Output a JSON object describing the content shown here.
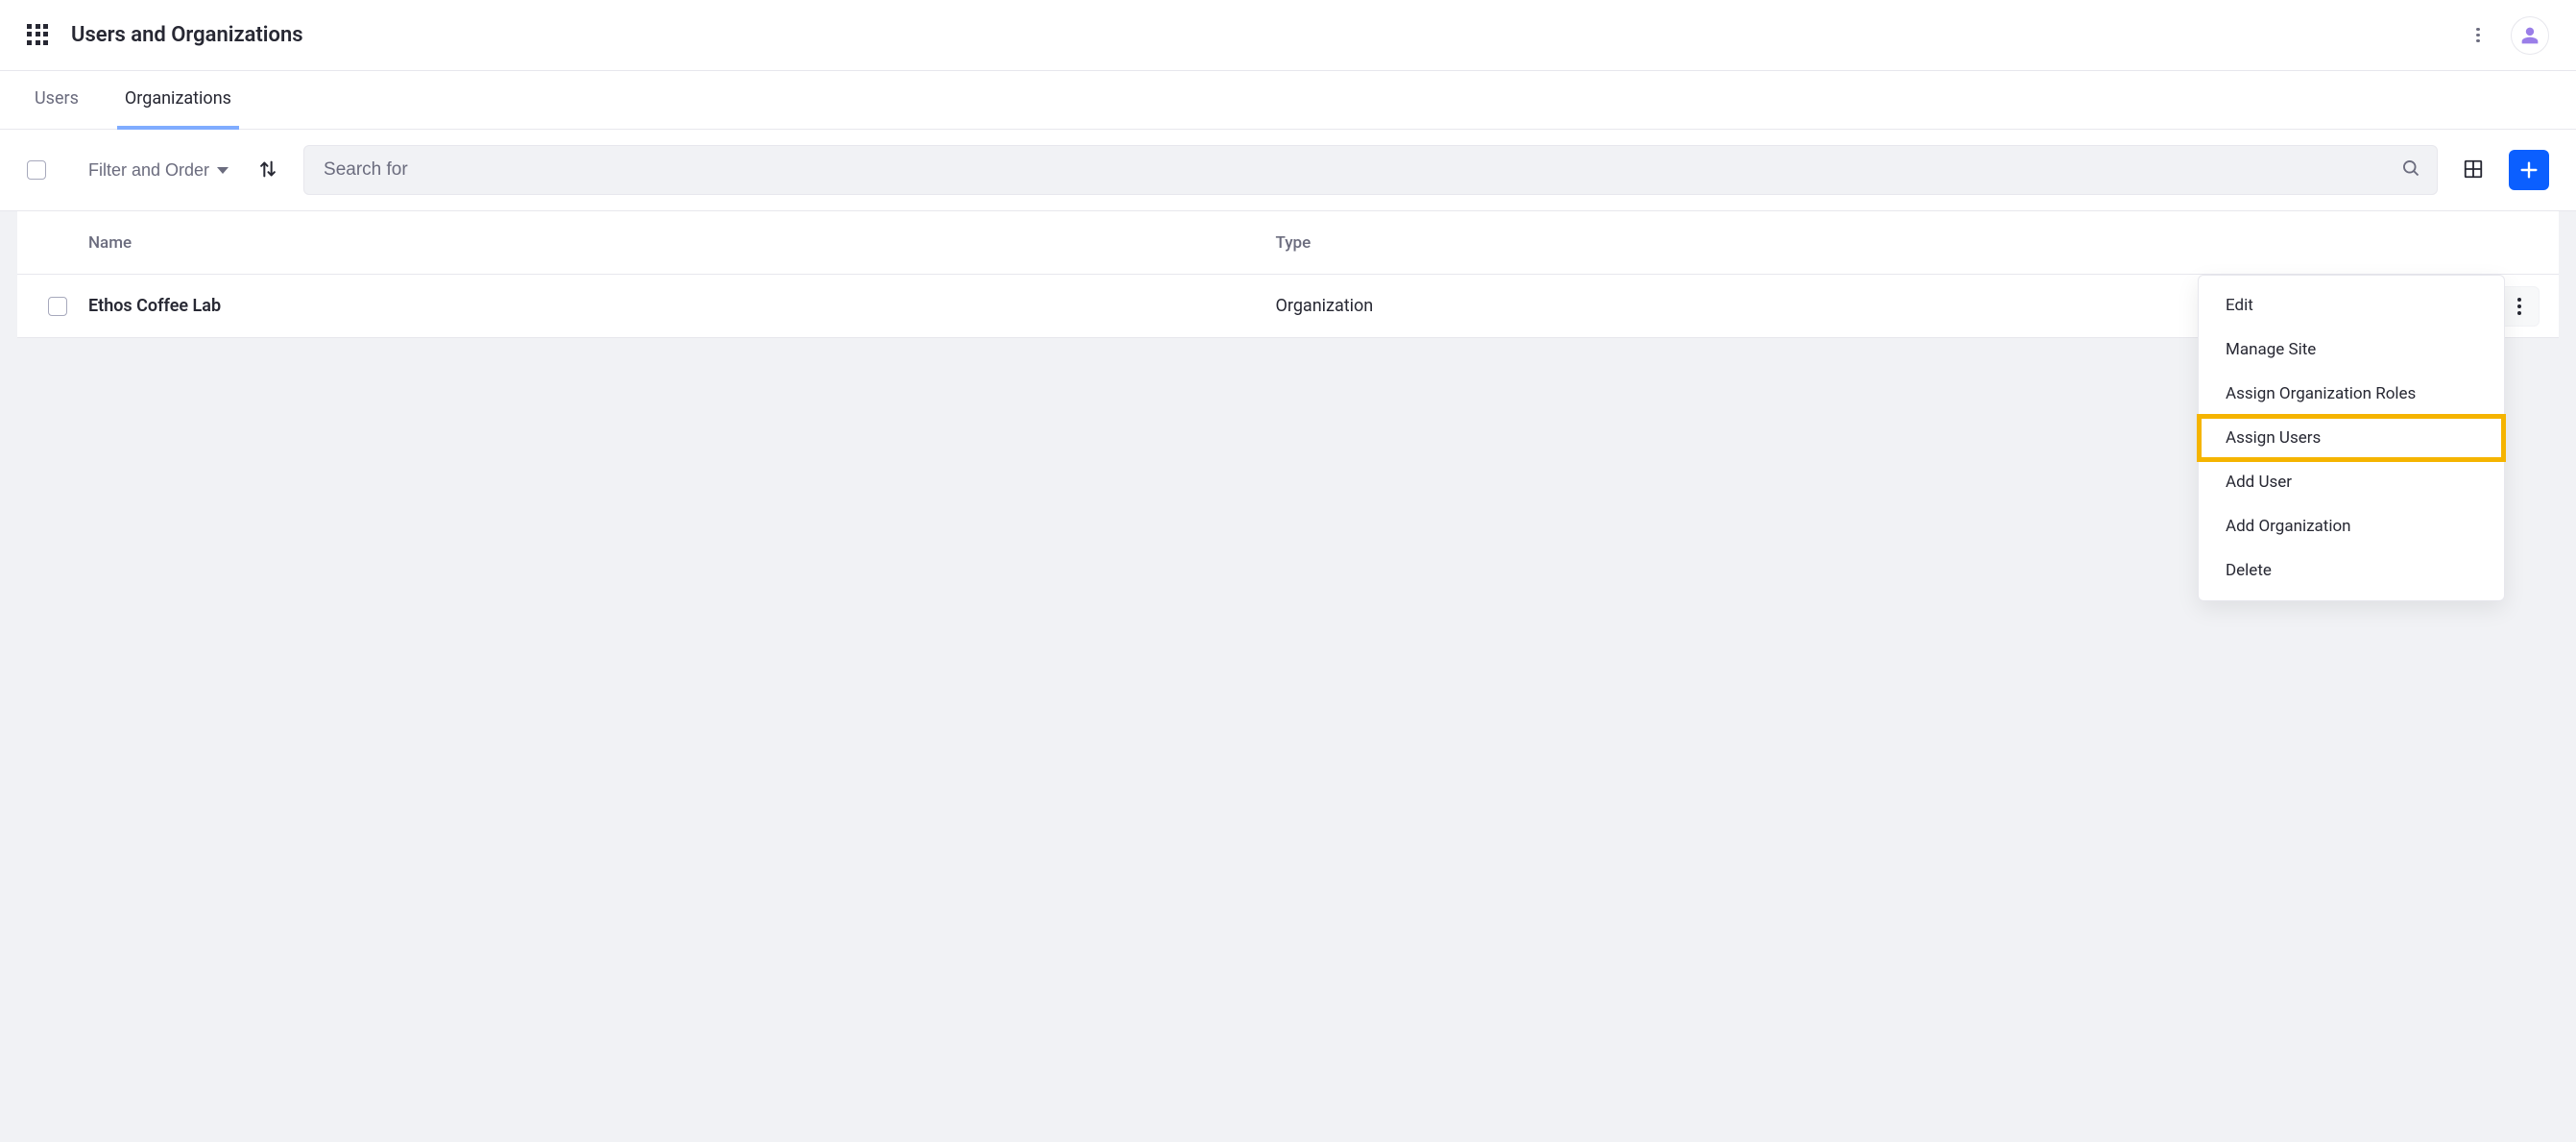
{
  "header": {
    "title": "Users and Organizations"
  },
  "tabs": [
    {
      "label": "Users",
      "active": false
    },
    {
      "label": "Organizations",
      "active": true
    }
  ],
  "toolbar": {
    "filter_label": "Filter and Order",
    "search_placeholder": "Search for"
  },
  "table": {
    "columns": {
      "name": "Name",
      "type": "Type"
    },
    "rows": [
      {
        "name": "Ethos Coffee Lab",
        "type": "Organization"
      }
    ]
  },
  "dropdown": {
    "items": [
      {
        "label": "Edit"
      },
      {
        "label": "Manage Site"
      },
      {
        "label": "Assign Organization Roles"
      },
      {
        "label": "Assign Users",
        "highlighted": true
      },
      {
        "label": "Add User"
      },
      {
        "label": "Add Organization"
      },
      {
        "label": "Delete"
      }
    ]
  }
}
